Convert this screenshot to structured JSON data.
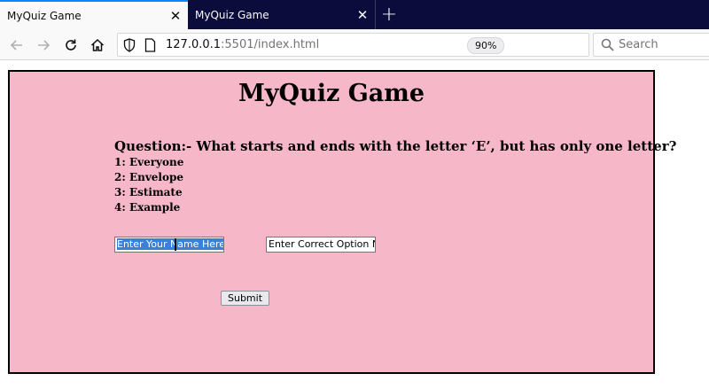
{
  "browser": {
    "tabs": [
      {
        "title": "MyQuiz Game",
        "active": true
      },
      {
        "title": "MyQuiz Game",
        "active": false
      }
    ],
    "url_host": "127.0.0.1",
    "url_rest": ":5501/index.html",
    "zoom": "90%",
    "search_placeholder": "Search"
  },
  "quiz": {
    "title": "MyQuiz Game",
    "question": "Question:- What starts and ends with the letter ‘E’, but has only one letter?",
    "options": [
      "1: Everyone",
      "2: Envelope",
      "3: Estimate",
      "4: Example"
    ],
    "name_placeholder": "Enter Your Name Here..",
    "option_placeholder": "Enter Correct Option No",
    "submit_label": "Submit"
  },
  "colors": {
    "quiz_background": "#f6b7c9",
    "tab_accent": "#0a84ff",
    "text_selection": "#3a80d9"
  }
}
